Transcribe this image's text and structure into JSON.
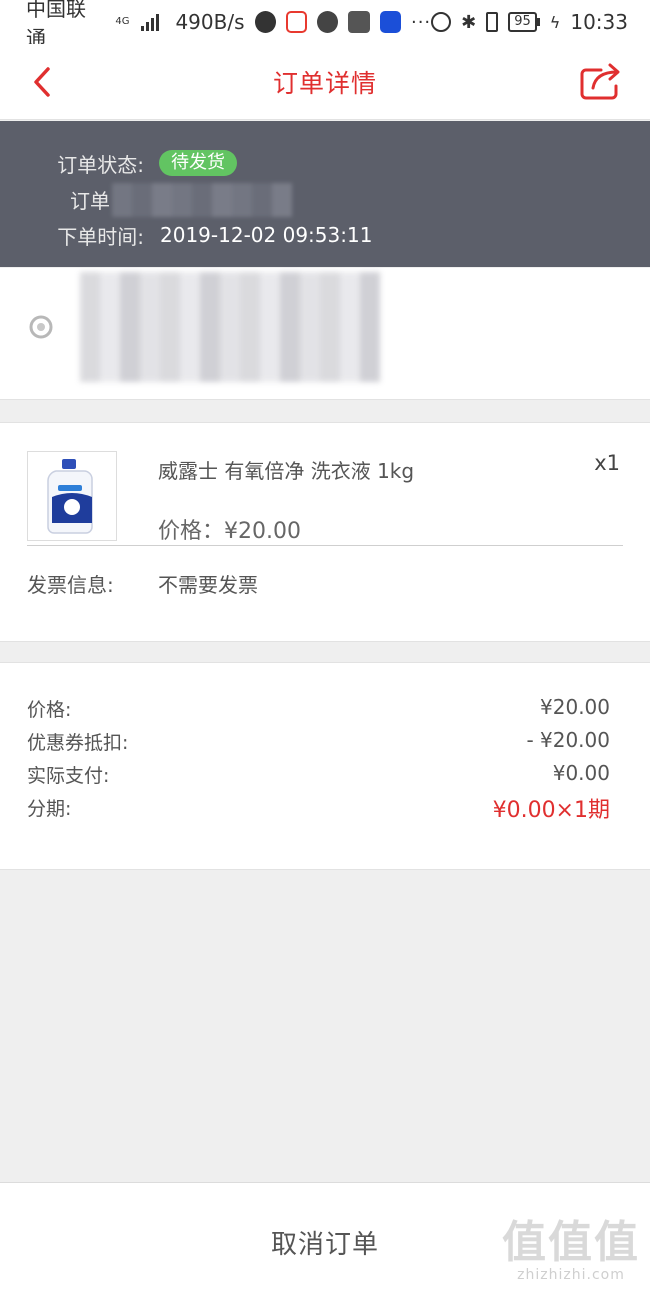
{
  "status_bar": {
    "carrier": "中国联通",
    "network": "4G",
    "speed": "490B/s",
    "more": "···",
    "battery": "95",
    "time": "10:33"
  },
  "nav": {
    "title": "订单详情"
  },
  "order_status": {
    "status_label": "订单状态:",
    "status_value": "待发货",
    "order_no_label": "订单",
    "time_label": "下单时间:",
    "time_value": "2019-12-02 09:53:11"
  },
  "product": {
    "name": "威露士 有氧倍净 洗衣液 1kg",
    "qty": "x1",
    "price": "价格：¥20.00",
    "invoice_label": "发票信息:",
    "invoice_value": "不需要发票"
  },
  "summary": {
    "rows": [
      {
        "label": "价格:",
        "value": "¥20.00"
      },
      {
        "label": "优惠券抵扣:",
        "value": "- ¥20.00"
      },
      {
        "label": "实际支付:",
        "value": "¥0.00"
      },
      {
        "label": "分期:",
        "value": "¥0.00×1期"
      }
    ],
    "highlight_color": "#e02f2f"
  },
  "footer": {
    "cancel_label": "取消订单"
  },
  "watermark": {
    "logo": "值值值",
    "text": "zhizhizhi.com"
  },
  "colors": {
    "accent": "#e02f2f",
    "status_panel": "#5c5f6a",
    "badge": "#62c462"
  }
}
